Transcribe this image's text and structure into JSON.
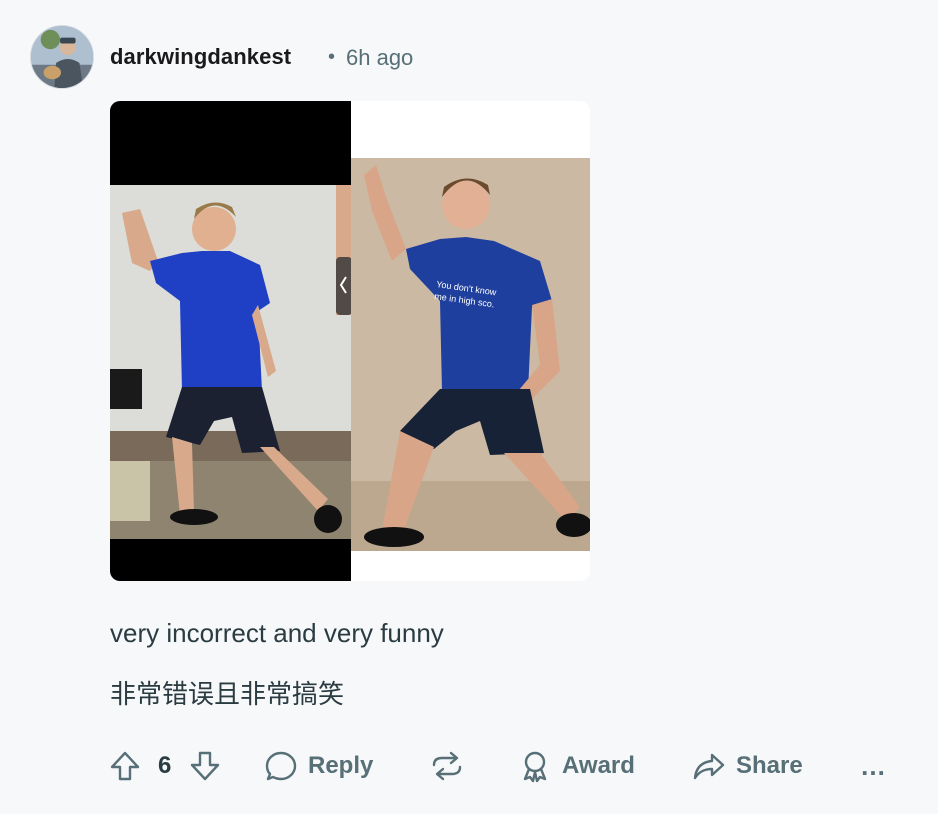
{
  "comment": {
    "username": "darkwingdankest",
    "separator": "•",
    "timestamp": "6h ago",
    "body_en": "very incorrect and very funny",
    "body_zh": "非常错误且非常搞笑",
    "image_left_shirt_text": "",
    "image_right_shirt_text_line1": "You don't know",
    "image_right_shirt_text_line2": "me in high sco."
  },
  "actions": {
    "score": "6",
    "reply_label": "Reply",
    "award_label": "Award",
    "share_label": "Share",
    "more_label": "…"
  },
  "icons": {
    "upvote": "upvote-arrow-icon",
    "downvote": "downvote-arrow-icon",
    "reply": "speech-bubble-icon",
    "repost": "repost-icon",
    "award": "award-ribbon-icon",
    "share": "share-arrow-icon",
    "more": "more-dots-icon"
  },
  "colors": {
    "background": "#f7f8fa",
    "meta_text": "#576f76",
    "body_text": "#2a3c42"
  }
}
